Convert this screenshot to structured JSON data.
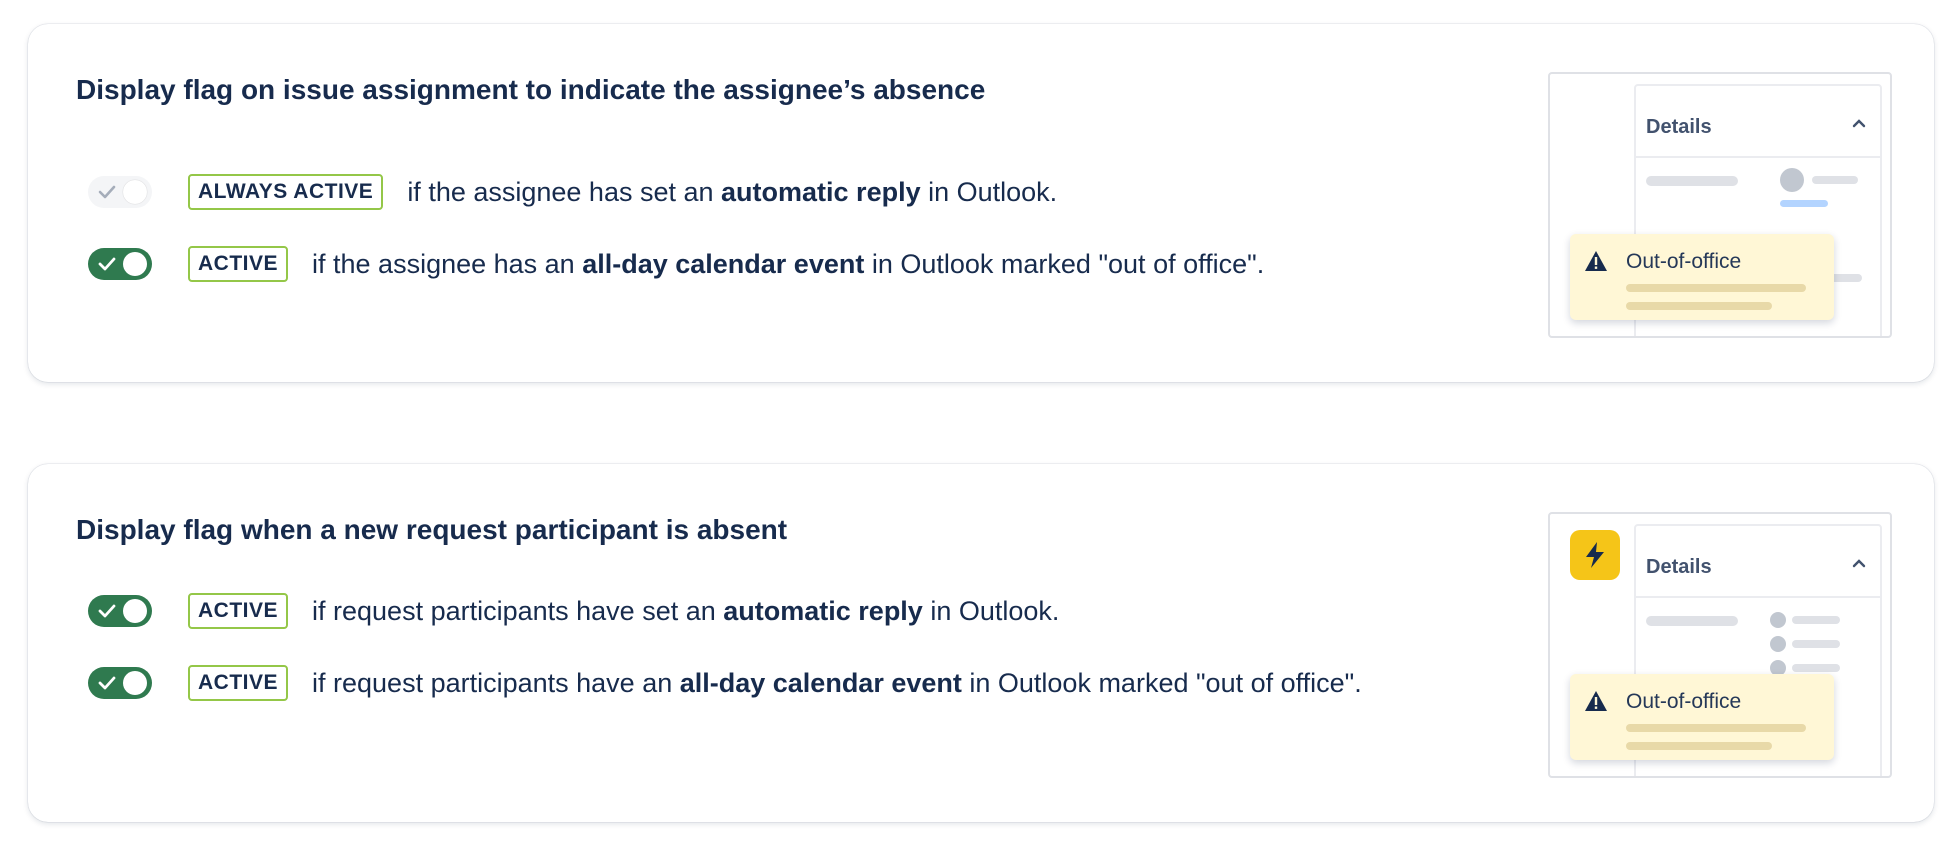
{
  "colors": {
    "toggle_on": "#2f7a4f",
    "badge_border": "#94c748",
    "text": "#172b4d",
    "ooo_bg": "#fff7d6",
    "app_icon": "#f5c518"
  },
  "sections": [
    {
      "title": "Display flag on issue assignment to indicate the assignee’s absence",
      "rules": [
        {
          "enabled": true,
          "toggle_disabled": true,
          "badge": "ALWAYS ACTIVE",
          "text_pre": "if the assignee has set an ",
          "text_bold": "automatic reply",
          "text_post": " in Outlook."
        },
        {
          "enabled": true,
          "toggle_disabled": false,
          "badge": "ACTIVE",
          "text_pre": "if the assignee has an ",
          "text_bold": "all-day calendar event",
          "text_post": " in Outlook marked \"out of office\"."
        }
      ],
      "illustration": {
        "panel_title": "Details",
        "flag_label": "Out-of-office",
        "icons": [
          "chevron-up-icon",
          "warning-icon"
        ]
      }
    },
    {
      "title": "Display flag when a new request participant is absent",
      "rules": [
        {
          "enabled": true,
          "toggle_disabled": false,
          "badge": "ACTIVE",
          "text_pre": "if request participants have set an ",
          "text_bold": "automatic reply",
          "text_post": " in Outlook."
        },
        {
          "enabled": true,
          "toggle_disabled": false,
          "badge": "ACTIVE",
          "text_pre": "if request participants have an ",
          "text_bold": "all-day calendar event",
          "text_post": " in Outlook marked \"out of office\"."
        }
      ],
      "illustration": {
        "panel_title": "Details",
        "flag_label": "Out-of-office",
        "icons": [
          "lightning-icon",
          "chevron-up-icon",
          "warning-icon"
        ]
      }
    }
  ]
}
